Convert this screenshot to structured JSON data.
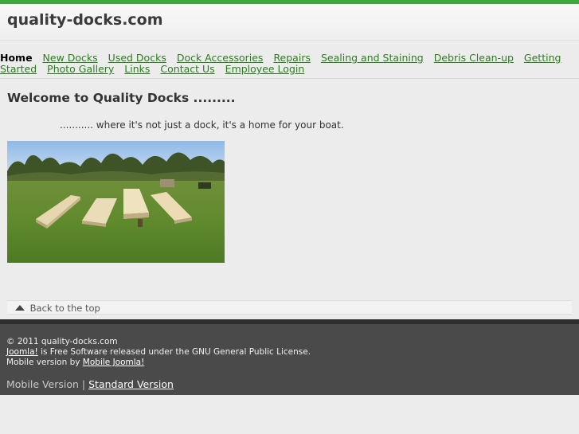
{
  "header": {
    "site_title": "quality-docks.com"
  },
  "nav": {
    "items": [
      {
        "label": "Home",
        "current": true
      },
      {
        "label": "New Docks"
      },
      {
        "label": "Used Docks"
      },
      {
        "label": "Dock Accessories"
      },
      {
        "label": "Repairs"
      },
      {
        "label": "Sealing and Staining"
      },
      {
        "label": "Debris Clean-up"
      },
      {
        "label": "Getting Started"
      },
      {
        "label": "Photo Gallery"
      },
      {
        "label": "Links"
      },
      {
        "label": "Contact Us"
      },
      {
        "label": "Employee Login"
      }
    ]
  },
  "main": {
    "title": "Welcome to Quality Docks .........",
    "tagline": "...........  where it's not just a dock, it's a home for your boat."
  },
  "back_to_top": {
    "label": "Back to the top",
    "icon": "triangle-up-icon"
  },
  "footer": {
    "copyright": "© 2011 quality-docks.com",
    "joomla_link": "Joomla!",
    "joomla_text": " is Free Software released under the GNU General Public License.",
    "mobile_by_text": "Mobile version by ",
    "mobile_joomla_link": "Mobile Joomla!",
    "mobile_version_label": "Mobile Version",
    "separator": " | ",
    "standard_version_link": "Standard Version"
  },
  "colors": {
    "accent_green": "#3ea63b",
    "link_green": "#2c7d1f",
    "footer_bg": "#4a4a4a"
  }
}
